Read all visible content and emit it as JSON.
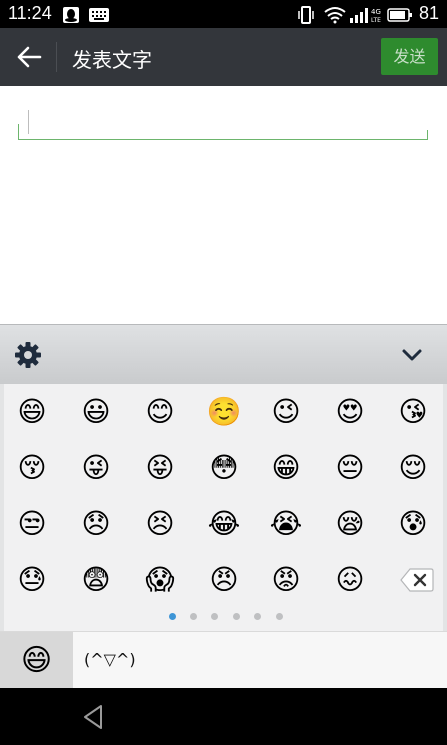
{
  "status_bar": {
    "time": "11:24",
    "battery": "81",
    "network_badge": "4G LTE",
    "icons": [
      "qq-icon",
      "keyboard-icon",
      "vibrate-icon",
      "wifi-icon",
      "signal-icon",
      "battery-icon"
    ]
  },
  "app_bar": {
    "title": "发表文字",
    "send_label": "发送",
    "send_color": "#2e8b2e"
  },
  "compose": {
    "value": "",
    "underline_color": "#6db56d"
  },
  "emoji_panel": {
    "rows": [
      [
        "😄",
        "😃",
        "😊",
        "☺️",
        "😉",
        "😍",
        "😘"
      ],
      [
        "😚",
        "😜",
        "😝",
        "😳",
        "😁",
        "😔",
        "😌"
      ],
      [
        "😒",
        "😞",
        "😣",
        "😂",
        "😭",
        "😪",
        "😰"
      ],
      [
        "😓",
        "😨",
        "😱",
        "😠",
        "😡",
        "😖"
      ]
    ],
    "page_count": 6,
    "active_page": 0,
    "active_dot_color": "#3e95d6"
  },
  "category_bar": {
    "emoji_tab": "😄",
    "kaomoji_tab": "(^▽^)"
  }
}
